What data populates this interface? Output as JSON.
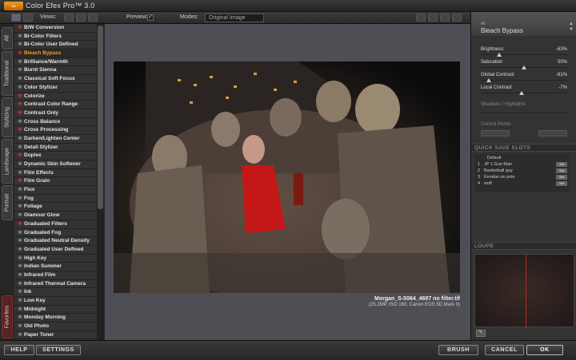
{
  "app": {
    "title": "Color Efex Pro™ 3.0",
    "badge": "Nik"
  },
  "toolbar": {
    "views_label": "Views:",
    "preview_label": "Preview:",
    "preview_checked": "✓",
    "modes_label": "Modes:",
    "mode_value": "Original Image"
  },
  "tabs": [
    "All",
    "Traditional",
    "Stylizing",
    "Landscape",
    "Portrait",
    "Favorites"
  ],
  "filters": [
    {
      "label": "B/W Conversion",
      "fav": true
    },
    {
      "label": "Bi-Color Filters",
      "fav": false
    },
    {
      "label": "Bi-Color User Defined",
      "fav": false
    },
    {
      "label": "Bleach Bypass",
      "fav": true,
      "selected": true
    },
    {
      "label": "Brilliance/Warmth",
      "fav": false
    },
    {
      "label": "Burnt Sienna",
      "fav": false
    },
    {
      "label": "Classical Soft Focus",
      "fav": false
    },
    {
      "label": "Color Stylizer",
      "fav": false
    },
    {
      "label": "Colorize",
      "fav": true
    },
    {
      "label": "Contrast Color Range",
      "fav": true
    },
    {
      "label": "Contrast Only",
      "fav": true
    },
    {
      "label": "Cross Balance",
      "fav": false
    },
    {
      "label": "Cross Processing",
      "fav": true
    },
    {
      "label": "Darken/Lighten Center",
      "fav": false
    },
    {
      "label": "Detail Stylizer",
      "fav": false
    },
    {
      "label": "Duplex",
      "fav": true
    },
    {
      "label": "Dynamic Skin Softener",
      "fav": false
    },
    {
      "label": "Film Effects",
      "fav": false
    },
    {
      "label": "Film Grain",
      "fav": true
    },
    {
      "label": "Flux",
      "fav": false
    },
    {
      "label": "Fog",
      "fav": false
    },
    {
      "label": "Foliage",
      "fav": false
    },
    {
      "label": "Glamour Glow",
      "fav": false
    },
    {
      "label": "Graduated Filters",
      "fav": true
    },
    {
      "label": "Graduated Fog",
      "fav": false
    },
    {
      "label": "Graduated Neutral Density",
      "fav": false
    },
    {
      "label": "Graduated User Defined",
      "fav": false
    },
    {
      "label": "High Key",
      "fav": false
    },
    {
      "label": "Indian Summer",
      "fav": false
    },
    {
      "label": "Infrared Film",
      "fav": false
    },
    {
      "label": "Infrared Thermal Camera",
      "fav": false
    },
    {
      "label": "Ink",
      "fav": false
    },
    {
      "label": "Low Key",
      "fav": false
    },
    {
      "label": "Midnight",
      "fav": false
    },
    {
      "label": "Monday Morning",
      "fav": false
    },
    {
      "label": "Old Photo",
      "fav": false
    },
    {
      "label": "Paper Toner",
      "fav": false
    }
  ],
  "preview": {
    "filename": "Morgan_S-5064_4697 no filter.tif",
    "fileinfo": "(25.2MP, ISO 160, Canon EOS 5D Mark II)"
  },
  "panel": {
    "category": "All",
    "filter_name": "Bleach Bypass",
    "params": [
      {
        "label": "Brightness",
        "value": "-63%",
        "pos": 0.21
      },
      {
        "label": "Saturation",
        "value": "50%",
        "pos": 0.5
      },
      {
        "label": "Global Contrast",
        "value": "-81%",
        "pos": 0.09
      },
      {
        "label": "Local Contrast",
        "value": "-7%",
        "pos": 0.47
      }
    ],
    "shadows_label": "Shadows / Highlights",
    "control_points_label": "Control Points",
    "qss_title": "QUICK SAVE SLOTS",
    "default_label": "Default",
    "slots": [
      {
        "num": "1",
        "name": "JP 1 Gun Man",
        "btn": "Set"
      },
      {
        "num": "2",
        "name": "Basketball guy",
        "btn": "Set"
      },
      {
        "num": "3",
        "name": "Kendon on pole",
        "btn": "Set"
      },
      {
        "num": "4",
        "name": "wolf",
        "btn": "Set"
      }
    ],
    "loupe_title": "LOUPE"
  },
  "bottom": {
    "help": "HELP",
    "settings": "SETTINGS",
    "brush": "BRUSH",
    "cancel": "CANCEL",
    "ok": "OK"
  }
}
